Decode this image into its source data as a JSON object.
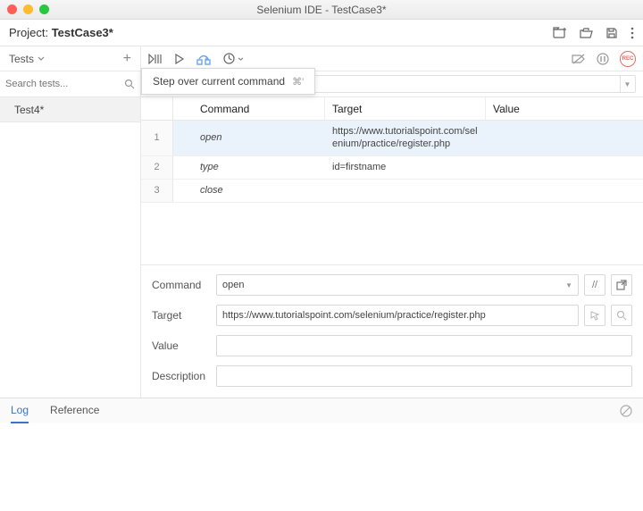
{
  "window": {
    "title": "Selenium IDE - TestCase3*"
  },
  "project": {
    "label": "Project:",
    "name": "TestCase3*"
  },
  "sidebar": {
    "heading": "Tests",
    "search_placeholder": "Search tests...",
    "tests": [
      {
        "name": "Test4*"
      }
    ]
  },
  "tooltip": {
    "text": "Step over current command",
    "shortcut": "⌘'"
  },
  "grid": {
    "headers": {
      "command": "Command",
      "target": "Target",
      "value": "Value"
    },
    "rows": [
      {
        "num": "1",
        "command": "open",
        "target": "https://www.tutorialspoint.com/selenium/practice/register.php",
        "value": "",
        "selected": true
      },
      {
        "num": "2",
        "command": "type",
        "target": "id=firstname",
        "value": "",
        "selected": false
      },
      {
        "num": "3",
        "command": "close",
        "target": "",
        "value": "",
        "selected": false
      }
    ]
  },
  "editor": {
    "labels": {
      "command": "Command",
      "target": "Target",
      "value": "Value",
      "description": "Description"
    },
    "command": "open",
    "target": "https://www.tutorialspoint.com/selenium/practice/register.php",
    "value": "",
    "description": "",
    "slash": "//"
  },
  "footer": {
    "log": "Log",
    "reference": "Reference"
  },
  "rec": "REC"
}
